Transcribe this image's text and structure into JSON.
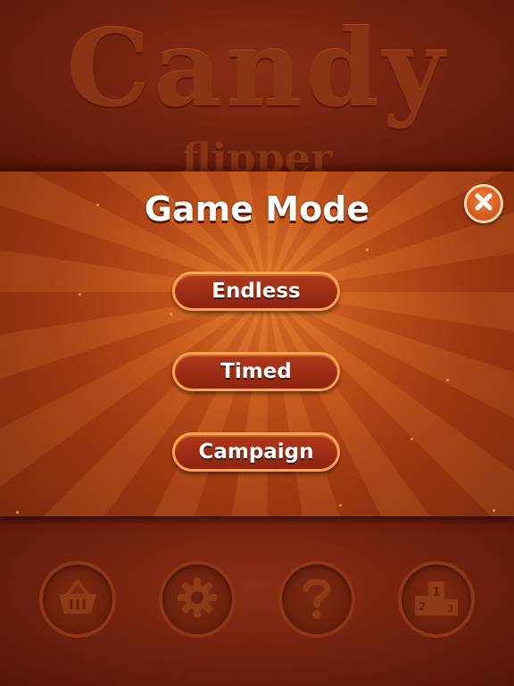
{
  "background": {
    "logo_title": "Candy",
    "logo_subtitle": "flipper"
  },
  "dialog": {
    "title": "Game Mode",
    "close_icon": "close-icon",
    "buttons": [
      {
        "label": "Endless"
      },
      {
        "label": "Timed"
      },
      {
        "label": "Campaign"
      }
    ]
  },
  "bottom_bar": {
    "icons": [
      "basket-icon",
      "gear-icon",
      "help-icon",
      "leaderboard-icon"
    ],
    "leaderboard_digits": [
      "1",
      "2",
      "3"
    ]
  },
  "colors": {
    "accent": "#d4571d",
    "button_border": "#ffa24a",
    "panel_center": "#e07a2a"
  }
}
